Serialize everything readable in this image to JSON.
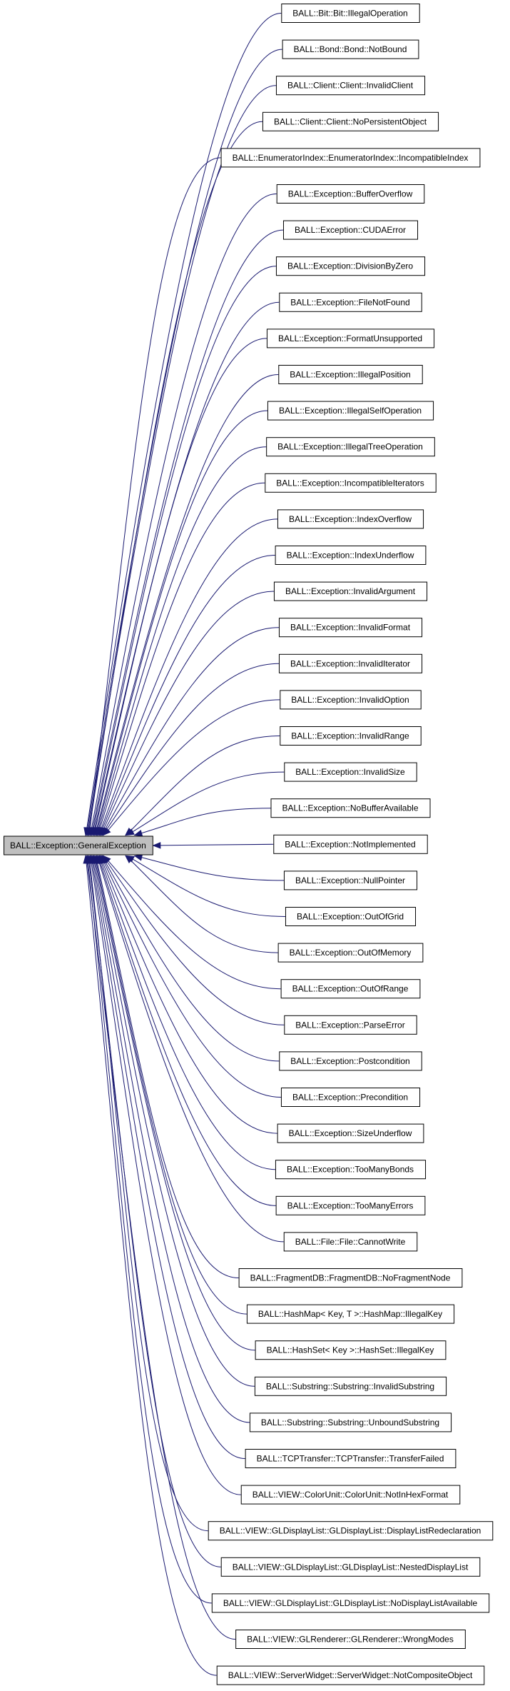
{
  "diagram": {
    "type": "inheritance-graph",
    "edge_color": "#191970",
    "root_fill": "#bfbfbf",
    "node_fill": "#ffffff",
    "root": {
      "label": "BALL::Exception::GeneralException"
    },
    "children": [
      {
        "label": "BALL::Bit::Bit::IllegalOperation"
      },
      {
        "label": "BALL::Bond::Bond::NotBound"
      },
      {
        "label": "BALL::Client::Client::InvalidClient"
      },
      {
        "label": "BALL::Client::Client::NoPersistentObject"
      },
      {
        "label": "BALL::EnumeratorIndex::EnumeratorIndex::IncompatibleIndex"
      },
      {
        "label": "BALL::Exception::BufferOverflow"
      },
      {
        "label": "BALL::Exception::CUDAError"
      },
      {
        "label": "BALL::Exception::DivisionByZero"
      },
      {
        "label": "BALL::Exception::FileNotFound"
      },
      {
        "label": "BALL::Exception::FormatUnsupported"
      },
      {
        "label": "BALL::Exception::IllegalPosition"
      },
      {
        "label": "BALL::Exception::IllegalSelfOperation"
      },
      {
        "label": "BALL::Exception::IllegalTreeOperation"
      },
      {
        "label": "BALL::Exception::IncompatibleIterators"
      },
      {
        "label": "BALL::Exception::IndexOverflow"
      },
      {
        "label": "BALL::Exception::IndexUnderflow"
      },
      {
        "label": "BALL::Exception::InvalidArgument"
      },
      {
        "label": "BALL::Exception::InvalidFormat"
      },
      {
        "label": "BALL::Exception::InvalidIterator"
      },
      {
        "label": "BALL::Exception::InvalidOption"
      },
      {
        "label": "BALL::Exception::InvalidRange"
      },
      {
        "label": "BALL::Exception::InvalidSize"
      },
      {
        "label": "BALL::Exception::NoBufferAvailable"
      },
      {
        "label": "BALL::Exception::NotImplemented"
      },
      {
        "label": "BALL::Exception::NullPointer"
      },
      {
        "label": "BALL::Exception::OutOfGrid"
      },
      {
        "label": "BALL::Exception::OutOfMemory"
      },
      {
        "label": "BALL::Exception::OutOfRange"
      },
      {
        "label": "BALL::Exception::ParseError"
      },
      {
        "label": "BALL::Exception::Postcondition"
      },
      {
        "label": "BALL::Exception::Precondition"
      },
      {
        "label": "BALL::Exception::SizeUnderflow"
      },
      {
        "label": "BALL::Exception::TooManyBonds"
      },
      {
        "label": "BALL::Exception::TooManyErrors"
      },
      {
        "label": "BALL::File::File::CannotWrite"
      },
      {
        "label": "BALL::FragmentDB::FragmentDB::NoFragmentNode"
      },
      {
        "label": "BALL::HashMap< Key, T >::HashMap::IllegalKey"
      },
      {
        "label": "BALL::HashSet< Key >::HashSet::IllegalKey"
      },
      {
        "label": "BALL::Substring::Substring::InvalidSubstring"
      },
      {
        "label": "BALL::Substring::Substring::UnboundSubstring"
      },
      {
        "label": "BALL::TCPTransfer::TCPTransfer::TransferFailed"
      },
      {
        "label": "BALL::VIEW::ColorUnit::ColorUnit::NotInHexFormat"
      },
      {
        "label": "BALL::VIEW::GLDisplayList::GLDisplayList::DisplayListRedeclaration"
      },
      {
        "label": "BALL::VIEW::GLDisplayList::GLDisplayList::NestedDisplayList"
      },
      {
        "label": "BALL::VIEW::GLDisplayList::GLDisplayList::NoDisplayListAvailable"
      },
      {
        "label": "BALL::VIEW::GLRenderer::GLRenderer::WrongModes"
      },
      {
        "label": "BALL::VIEW::ServerWidget::ServerWidget::NotCompositeObject"
      }
    ]
  }
}
